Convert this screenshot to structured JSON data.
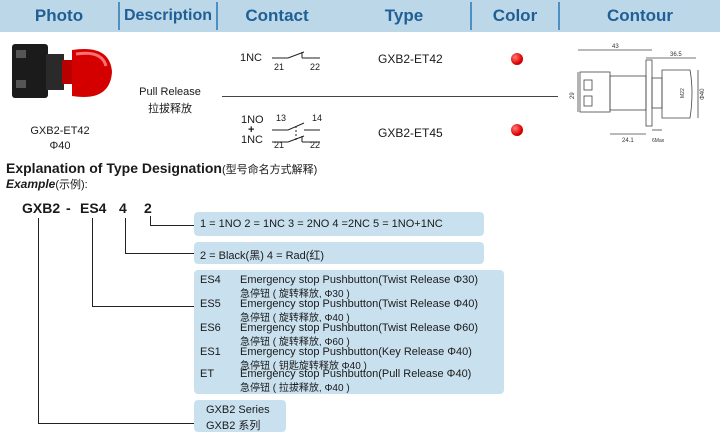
{
  "header": {
    "photo": "Photo",
    "description": "Description",
    "contact": "Contact",
    "type": "Type",
    "color": "Color",
    "contour": "Contour"
  },
  "product": {
    "model": "GXB2-ET42",
    "diameter": "Φ40",
    "description_en": "Pull Release",
    "description_cn": "拉拔释放",
    "variants": [
      {
        "contact_lines": [
          "1NC"
        ],
        "terminals": [
          "21",
          "22"
        ],
        "type": "GXB2-ET42",
        "color": "#e00000"
      },
      {
        "contact_lines": [
          "1NO",
          "+",
          "1NC"
        ],
        "terminals_top": [
          "13",
          "14"
        ],
        "terminals_bottom": [
          "21",
          "22"
        ],
        "type": "GXB2-ET45",
        "color": "#e00000"
      }
    ],
    "contour_dims": {
      "total": "43",
      "head": "36.5",
      "height": "29",
      "thread": "M22",
      "dia": "Φ40",
      "base": "24.1",
      "panel": "6Max"
    }
  },
  "designation": {
    "title": "Explanation of Type Designation",
    "title_cn": "(型号命名方式解释)",
    "example_label": "Example",
    "example_cn": "(示例):",
    "code": {
      "series": "GXB2",
      "dash": "-",
      "type": "ES4",
      "color": "4",
      "contact": "2"
    },
    "contact_box": "1 = 1NO   2 = 1NC  3 = 2NO 4 =2NC 5 = 1NO+1NC",
    "color_box": "2 = Black(黑)   4 = Rad(红)",
    "types": [
      {
        "code": "ES4",
        "en": "Emergency stop Pushbutton(Twist Release  Φ30)",
        "cn": "急停钮 ( 旋转释放, Φ30 )"
      },
      {
        "code": "ES5",
        "en": "Emergency stop Pushbutton(Twist Release  Φ40)",
        "cn": "急停钮 ( 旋转释放, Φ40 )"
      },
      {
        "code": "ES6",
        "en": "Emergency stop Pushbutton(Twist Release  Φ60)",
        "cn": "急停钮 ( 旋转释放, Φ60 )"
      },
      {
        "code": "ES1",
        "en": "Emergency stop Pushbutton(Key Release      Φ40)",
        "cn": "急停钮 ( 钥匙旋转释放  Φ40 )"
      },
      {
        "code": "ET",
        "en": "Emergency stop Pushbutton(Pull Release      Φ40)",
        "cn": "急停钮 ( 拉拔释放, Φ40 )"
      }
    ],
    "series_box": {
      "en": "GXB2 Series",
      "cn": "GXB2 系列"
    }
  }
}
